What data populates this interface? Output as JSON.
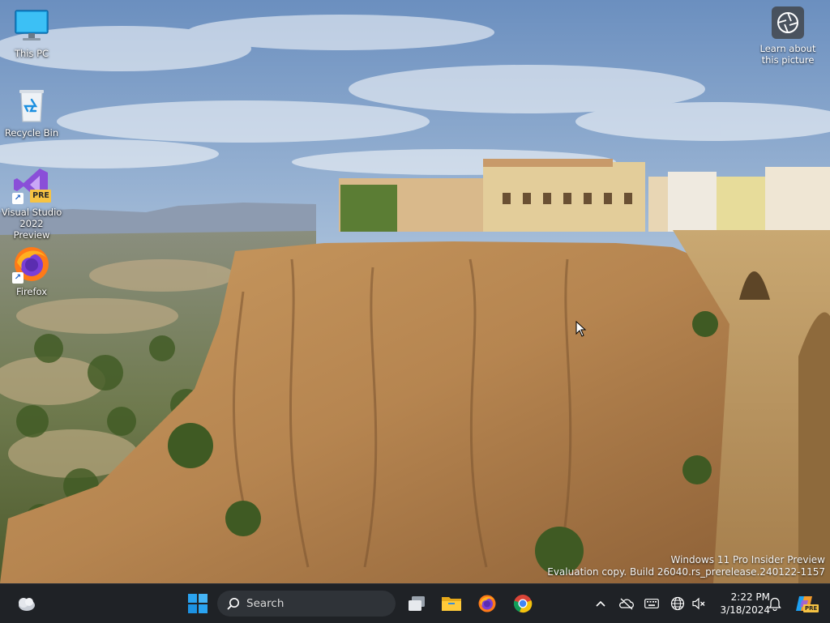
{
  "desktop": {
    "icons": [
      {
        "label": "This PC",
        "icon": "monitor-icon"
      },
      {
        "label": "Recycle Bin",
        "icon": "recycle-bin-icon"
      },
      {
        "label": "Visual Studio 2022 Preview",
        "icon": "visual-studio-icon",
        "badge": "PRE"
      },
      {
        "label": "Firefox",
        "icon": "firefox-icon"
      }
    ],
    "learn_label": "Learn about this picture",
    "watermark": {
      "line1": "Windows 11 Pro Insider Preview",
      "line2": "Evaluation copy. Build 26040.rs_prerelease.240122-1157"
    }
  },
  "taskbar": {
    "search_placeholder": "Search",
    "apps": [
      "widgets-icon",
      "start-icon",
      "task-view-icon",
      "file-explorer-icon",
      "firefox-icon",
      "chrome-icon"
    ],
    "tray": [
      "chevron-up-icon",
      "onedrive-icon",
      "keyboard-icon",
      "network-icon",
      "volume-muted-icon",
      "notification-bell-icon",
      "copilot-icon"
    ],
    "copilot_badge": "PRE",
    "clock": {
      "time": "2:22 PM",
      "date": "3/18/2024"
    }
  },
  "colors": {
    "taskbar": "#1f2226",
    "start_blue": "#2aa3f0",
    "sky": "#7aa0c8",
    "cliff": "#b98a52"
  }
}
